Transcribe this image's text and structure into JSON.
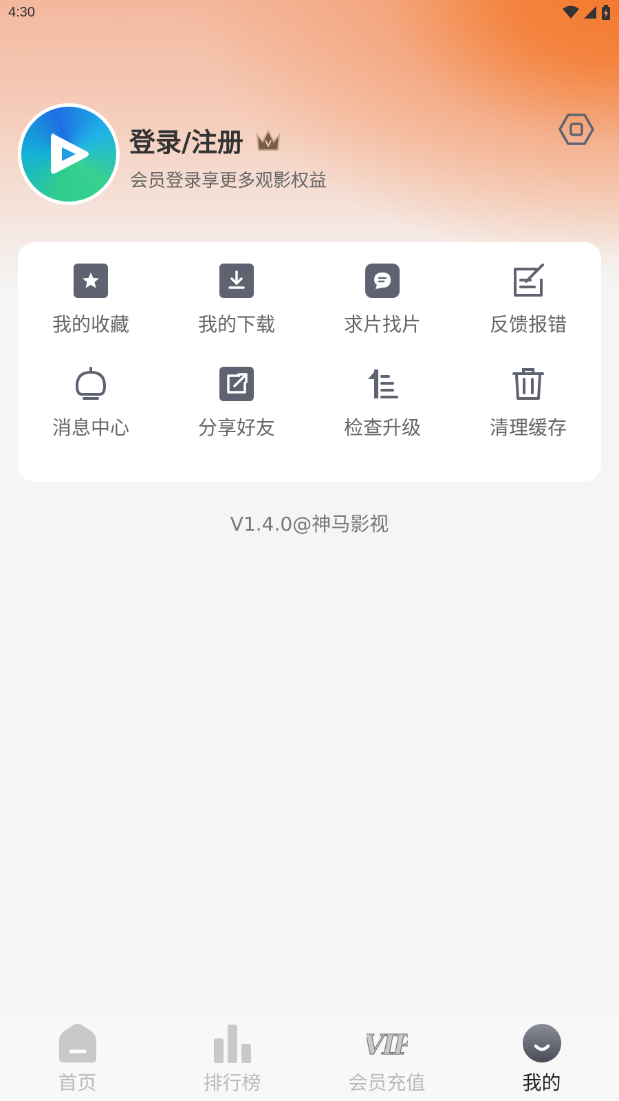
{
  "status_bar": {
    "time": "4:30"
  },
  "profile": {
    "title": "登录/注册",
    "subtitle": "会员登录享更多观影权益"
  },
  "menu": {
    "items": [
      {
        "label": "我的收藏",
        "icon": "star-icon"
      },
      {
        "label": "我的下载",
        "icon": "download-icon"
      },
      {
        "label": "求片找片",
        "icon": "chat-icon"
      },
      {
        "label": "反馈报错",
        "icon": "edit-icon"
      },
      {
        "label": "消息中心",
        "icon": "bell-icon"
      },
      {
        "label": "分享好友",
        "icon": "share-icon"
      },
      {
        "label": "检查升级",
        "icon": "upgrade-icon"
      },
      {
        "label": "清理缓存",
        "icon": "trash-icon"
      }
    ]
  },
  "version": "V1.4.0@神马影视",
  "tab_bar": {
    "tabs": [
      {
        "label": "首页",
        "icon": "home-icon",
        "active": false
      },
      {
        "label": "排行榜",
        "icon": "chart-icon",
        "active": false
      },
      {
        "label": "会员充值",
        "icon": "vip-icon",
        "active": false
      },
      {
        "label": "我的",
        "icon": "profile-icon",
        "active": true
      }
    ]
  },
  "colors": {
    "accent_orange": "#f47a2e",
    "icon_gray": "#5f6270",
    "text_dark": "#333333",
    "text_gray": "#666666"
  }
}
